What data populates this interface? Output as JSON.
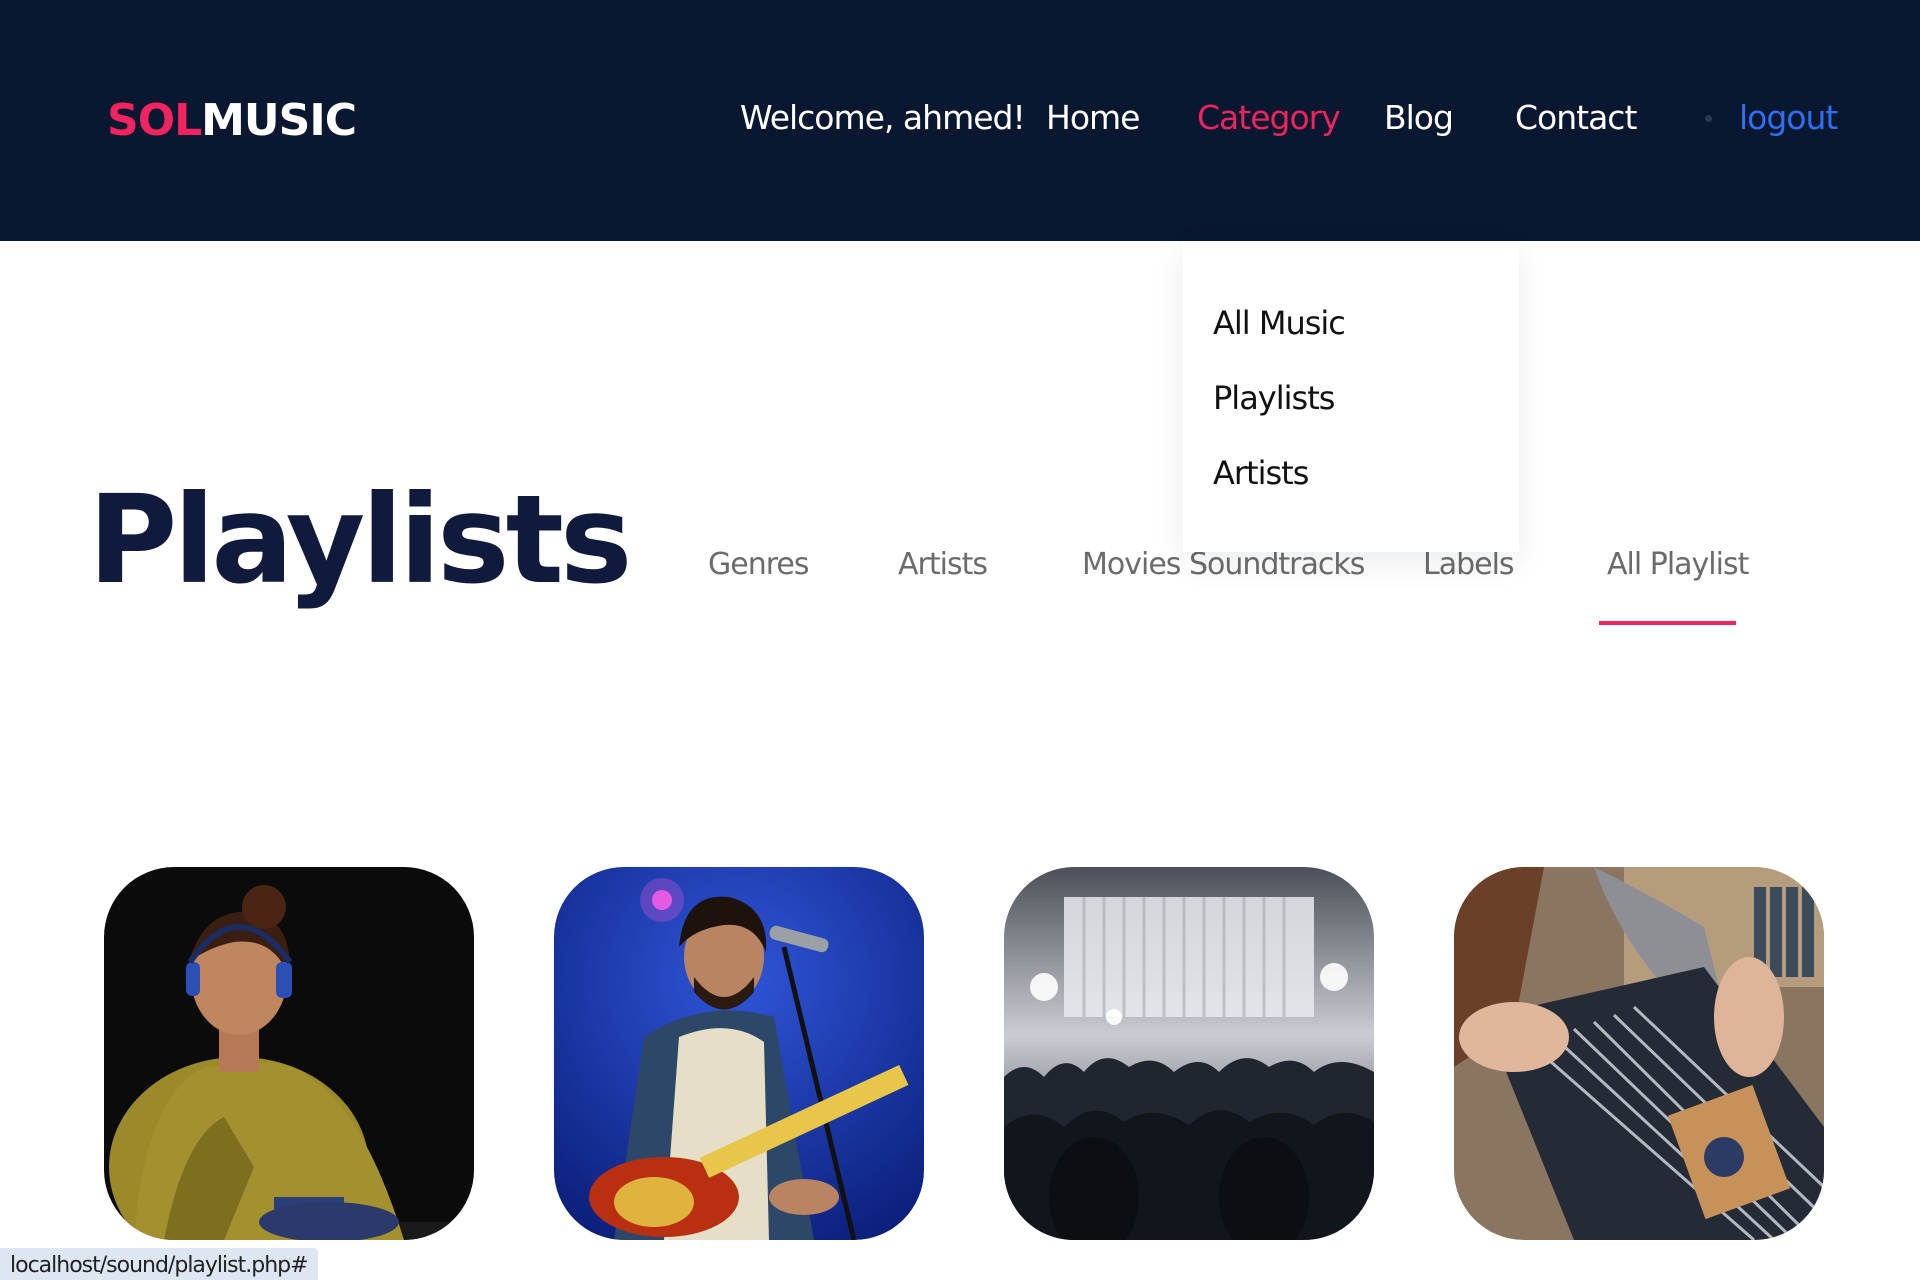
{
  "header": {
    "logo": {
      "part1": "SOL",
      "part2": "MUSIC"
    },
    "welcome": "Welcome, ahmed!",
    "nav": [
      {
        "label": "Home"
      },
      {
        "label": "Category"
      },
      {
        "label": "Blog"
      },
      {
        "label": "Contact"
      }
    ],
    "logout": "logout"
  },
  "dropdown": {
    "items": [
      {
        "label": "All Music"
      },
      {
        "label": "Playlists"
      },
      {
        "label": "Artists"
      }
    ]
  },
  "page": {
    "title": "Playlists",
    "tabs": [
      {
        "label": "Genres"
      },
      {
        "label": "Artists"
      },
      {
        "label": "Movies Soundtracks"
      },
      {
        "label": "Labels"
      },
      {
        "label": "All Playlist"
      }
    ],
    "active_tab": "All Playlist"
  },
  "cards": [
    {
      "image": "woman-with-headphones-photo"
    },
    {
      "image": "singer-with-guitar-on-stage-photo"
    },
    {
      "image": "concert-crowd-photo"
    },
    {
      "image": "vinyl-records-browsing-photo"
    }
  ],
  "statusbar": {
    "url": "localhost/sound/playlist.php#"
  },
  "colors": {
    "header_bg": "#0a1730",
    "accent": "#f0245e",
    "logout": "#2f6ff0",
    "title": "#0f1a3c",
    "tab_text": "#6b6b6b"
  }
}
